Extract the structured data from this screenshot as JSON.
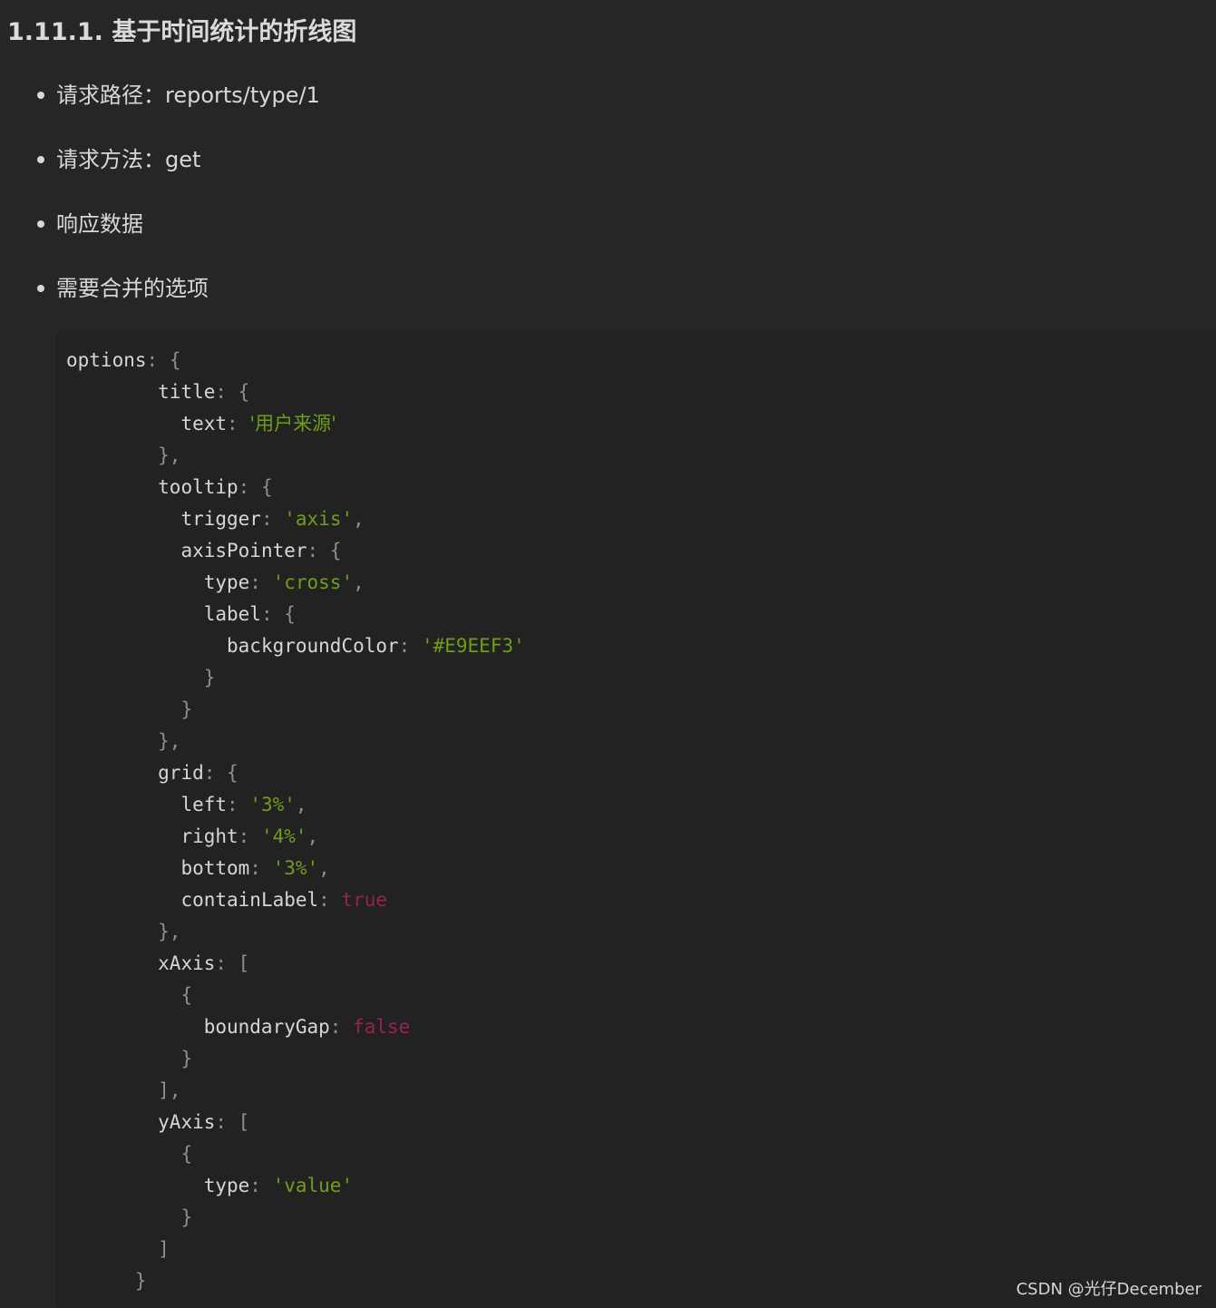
{
  "heading": "1.11.1. 基于时间统计的折线图",
  "bullets": [
    "请求路径：reports/type/1",
    "请求方法：get",
    "响应数据",
    "需要合并的选项"
  ],
  "code_lines": [
    [
      {
        "t": "options",
        "k": "key"
      },
      {
        "t": ": ",
        "k": "punct"
      },
      {
        "t": "{",
        "k": "punct"
      }
    ],
    [
      {
        "t": "        ",
        "k": "key"
      },
      {
        "t": "title",
        "k": "key"
      },
      {
        "t": ": ",
        "k": "punct"
      },
      {
        "t": "{",
        "k": "punct"
      }
    ],
    [
      {
        "t": "          ",
        "k": "key"
      },
      {
        "t": "text",
        "k": "key"
      },
      {
        "t": ": ",
        "k": "punct"
      },
      {
        "t": "'用户来源'",
        "k": "str"
      }
    ],
    [
      {
        "t": "        ",
        "k": "key"
      },
      {
        "t": "},",
        "k": "punct"
      }
    ],
    [
      {
        "t": "        ",
        "k": "key"
      },
      {
        "t": "tooltip",
        "k": "key"
      },
      {
        "t": ": ",
        "k": "punct"
      },
      {
        "t": "{",
        "k": "punct"
      }
    ],
    [
      {
        "t": "          ",
        "k": "key"
      },
      {
        "t": "trigger",
        "k": "key"
      },
      {
        "t": ": ",
        "k": "punct"
      },
      {
        "t": "'axis'",
        "k": "str"
      },
      {
        "t": ",",
        "k": "punct"
      }
    ],
    [
      {
        "t": "          ",
        "k": "key"
      },
      {
        "t": "axisPointer",
        "k": "key"
      },
      {
        "t": ": ",
        "k": "punct"
      },
      {
        "t": "{",
        "k": "punct"
      }
    ],
    [
      {
        "t": "            ",
        "k": "key"
      },
      {
        "t": "type",
        "k": "key"
      },
      {
        "t": ": ",
        "k": "punct"
      },
      {
        "t": "'cross'",
        "k": "str"
      },
      {
        "t": ",",
        "k": "punct"
      }
    ],
    [
      {
        "t": "            ",
        "k": "key"
      },
      {
        "t": "label",
        "k": "key"
      },
      {
        "t": ": ",
        "k": "punct"
      },
      {
        "t": "{",
        "k": "punct"
      }
    ],
    [
      {
        "t": "              ",
        "k": "key"
      },
      {
        "t": "backgroundColor",
        "k": "key"
      },
      {
        "t": ": ",
        "k": "punct"
      },
      {
        "t": "'#E9EEF3'",
        "k": "str"
      }
    ],
    [
      {
        "t": "            ",
        "k": "key"
      },
      {
        "t": "}",
        "k": "punct"
      }
    ],
    [
      {
        "t": "          ",
        "k": "key"
      },
      {
        "t": "}",
        "k": "punct"
      }
    ],
    [
      {
        "t": "        ",
        "k": "key"
      },
      {
        "t": "},",
        "k": "punct"
      }
    ],
    [
      {
        "t": "        ",
        "k": "key"
      },
      {
        "t": "grid",
        "k": "key"
      },
      {
        "t": ": ",
        "k": "punct"
      },
      {
        "t": "{",
        "k": "punct"
      }
    ],
    [
      {
        "t": "          ",
        "k": "key"
      },
      {
        "t": "left",
        "k": "key"
      },
      {
        "t": ": ",
        "k": "punct"
      },
      {
        "t": "'3%'",
        "k": "str"
      },
      {
        "t": ",",
        "k": "punct"
      }
    ],
    [
      {
        "t": "          ",
        "k": "key"
      },
      {
        "t": "right",
        "k": "key"
      },
      {
        "t": ": ",
        "k": "punct"
      },
      {
        "t": "'4%'",
        "k": "str"
      },
      {
        "t": ",",
        "k": "punct"
      }
    ],
    [
      {
        "t": "          ",
        "k": "key"
      },
      {
        "t": "bottom",
        "k": "key"
      },
      {
        "t": ": ",
        "k": "punct"
      },
      {
        "t": "'3%'",
        "k": "str"
      },
      {
        "t": ",",
        "k": "punct"
      }
    ],
    [
      {
        "t": "          ",
        "k": "key"
      },
      {
        "t": "containLabel",
        "k": "key"
      },
      {
        "t": ": ",
        "k": "punct"
      },
      {
        "t": "true",
        "k": "kw"
      }
    ],
    [
      {
        "t": "        ",
        "k": "key"
      },
      {
        "t": "},",
        "k": "punct"
      }
    ],
    [
      {
        "t": "        ",
        "k": "key"
      },
      {
        "t": "xAxis",
        "k": "key"
      },
      {
        "t": ": ",
        "k": "punct"
      },
      {
        "t": "[",
        "k": "punct"
      }
    ],
    [
      {
        "t": "          ",
        "k": "key"
      },
      {
        "t": "{",
        "k": "punct"
      }
    ],
    [
      {
        "t": "            ",
        "k": "key"
      },
      {
        "t": "boundaryGap",
        "k": "key"
      },
      {
        "t": ": ",
        "k": "punct"
      },
      {
        "t": "false",
        "k": "kw"
      }
    ],
    [
      {
        "t": "          ",
        "k": "key"
      },
      {
        "t": "}",
        "k": "punct"
      }
    ],
    [
      {
        "t": "        ",
        "k": "key"
      },
      {
        "t": "],",
        "k": "punct"
      }
    ],
    [
      {
        "t": "        ",
        "k": "key"
      },
      {
        "t": "yAxis",
        "k": "key"
      },
      {
        "t": ": ",
        "k": "punct"
      },
      {
        "t": "[",
        "k": "punct"
      }
    ],
    [
      {
        "t": "          ",
        "k": "key"
      },
      {
        "t": "{",
        "k": "punct"
      }
    ],
    [
      {
        "t": "            ",
        "k": "key"
      },
      {
        "t": "type",
        "k": "key"
      },
      {
        "t": ": ",
        "k": "punct"
      },
      {
        "t": "'value'",
        "k": "str"
      }
    ],
    [
      {
        "t": "          ",
        "k": "key"
      },
      {
        "t": "}",
        "k": "punct"
      }
    ],
    [
      {
        "t": "        ",
        "k": "key"
      },
      {
        "t": "]",
        "k": "punct"
      }
    ],
    [
      {
        "t": "      ",
        "k": "key"
      },
      {
        "t": "}",
        "k": "punct"
      }
    ]
  ],
  "watermark": "CSDN @光仔December",
  "colors": {
    "background": "#262626",
    "code_background": "#222222",
    "string": "#6f9e1b",
    "keyword": "#9b1f56",
    "punctuation": "#8f8f8f",
    "text": "#d6d6d6"
  }
}
